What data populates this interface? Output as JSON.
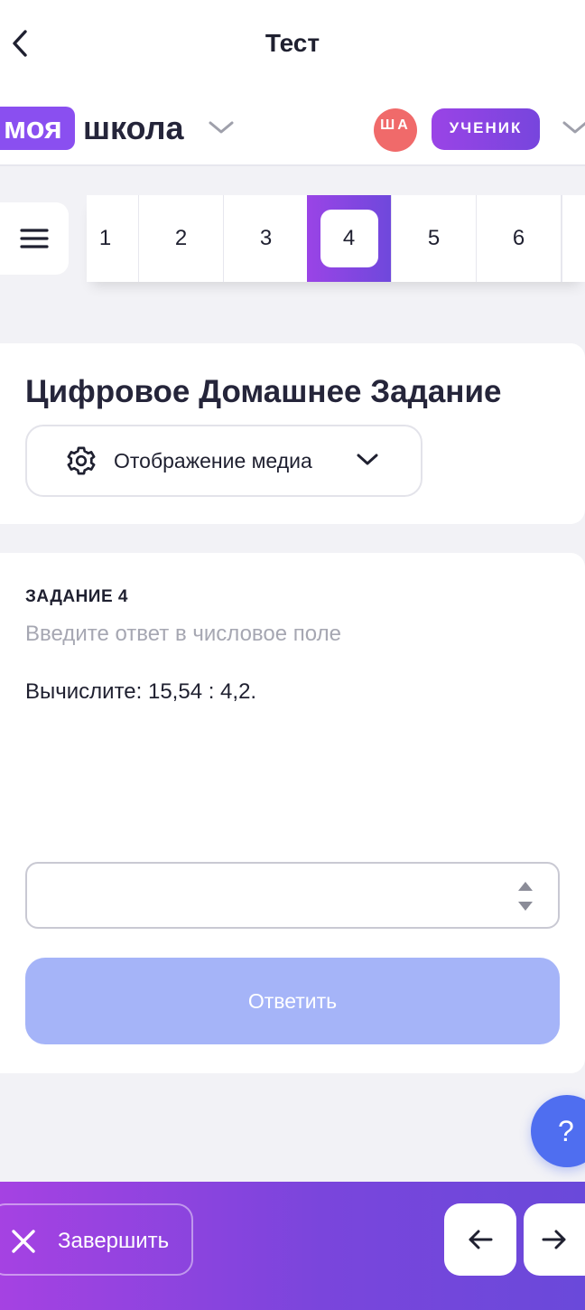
{
  "header": {
    "title": "Тест",
    "back_icon": "chevron-left-icon"
  },
  "brand": {
    "logo_badge": "моя",
    "logo_text": "школа",
    "avatar_initials": "ША",
    "avatar_color": "#f06a6a",
    "role": "УЧЕНИК",
    "accent": "#8a4ff0"
  },
  "question_nav": {
    "items": [
      "1",
      "2",
      "3",
      "4",
      "5",
      "6"
    ],
    "active": "4"
  },
  "homework": {
    "title": "Цифровое Домашнее Задание",
    "media_select_label": "Отображение медиа"
  },
  "task": {
    "label": "ЗАДАНИЕ 4",
    "hint": "Введите ответ в числовое поле",
    "question": "Вычислите: 15,54 : 4,2.",
    "answer_value": "",
    "submit_label": "Ответить",
    "submit_color": "#a5b4f8"
  },
  "help": {
    "label": "?"
  },
  "footer": {
    "finish_label": "Завершить",
    "prev_icon": "arrow-left-icon",
    "next_icon": "arrow-right-icon"
  }
}
